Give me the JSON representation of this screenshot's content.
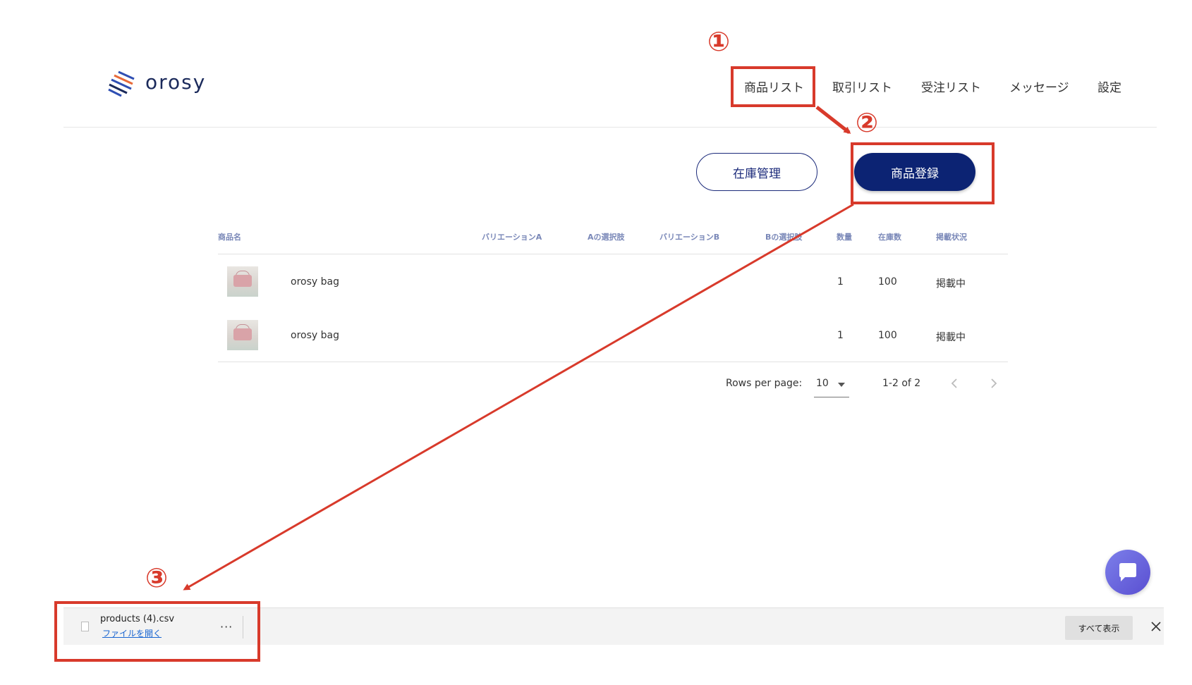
{
  "header": {
    "logo_text": "orosy",
    "nav": [
      "商品リスト",
      "取引リスト",
      "受注リスト",
      "メッセージ",
      "設定"
    ]
  },
  "actions": {
    "inventory_label": "在庫管理",
    "register_label": "商品登録"
  },
  "table": {
    "columns": [
      "商品名",
      "バリエーションA",
      "Aの選択肢",
      "バリエーションB",
      "Bの選択肢",
      "数量",
      "在庫数",
      "掲載状況"
    ],
    "rows": [
      {
        "name": "orosy bag",
        "quantity": "1",
        "stock": "100",
        "status": "掲載中"
      },
      {
        "name": "orosy bag",
        "quantity": "1",
        "stock": "100",
        "status": "掲載中"
      }
    ]
  },
  "pagination": {
    "rows_per_page_label": "Rows per page:",
    "rows_per_page_value": "10",
    "range": "1-2 of 2"
  },
  "download_bar": {
    "file_name": "products (4).csv",
    "open_label": "ファイルを開く",
    "more_label": "···",
    "show_all_label": "すべて表示"
  },
  "annotations": [
    "①",
    "②",
    "③"
  ],
  "colors": {
    "primary": "#0c2373",
    "annotation": "#d83a2b",
    "chat": "#6b63e0"
  }
}
